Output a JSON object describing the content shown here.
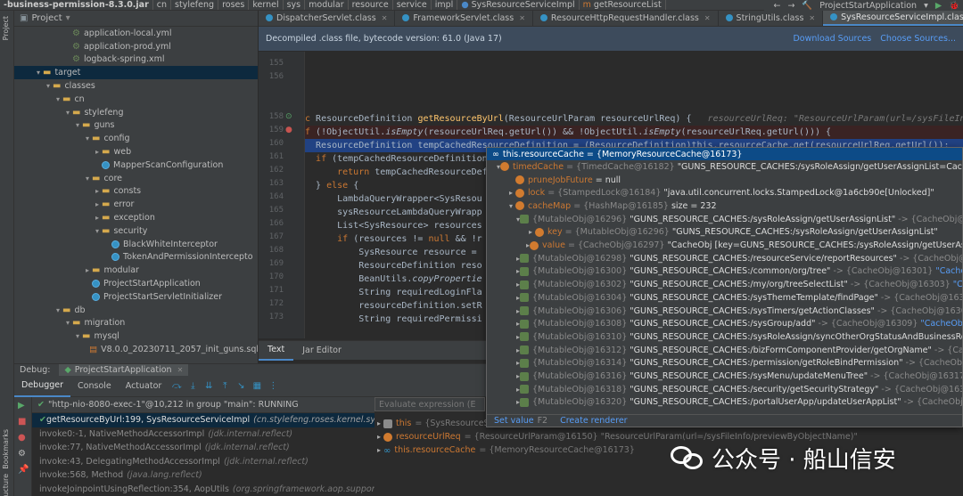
{
  "breadcrumbs": [
    "-business-permission-8.3.0.jar",
    "cn",
    "stylefeng",
    "roses",
    "kernel",
    "sys",
    "modular",
    "resource",
    "service",
    "impl",
    "SysResourceServiceImpl",
    "getResourceList"
  ],
  "run_config": "ProjectStartApplication",
  "project": {
    "title": "Project",
    "tree": [
      {
        "label": "application-local.yml",
        "indent": 5,
        "icon": "yml"
      },
      {
        "label": "application-prod.yml",
        "indent": 5,
        "icon": "yml"
      },
      {
        "label": "logback-spring.xml",
        "indent": 5,
        "icon": "yml"
      },
      {
        "label": "target",
        "indent": 2,
        "icon": "folder",
        "open": true,
        "selected": true
      },
      {
        "label": "classes",
        "indent": 3,
        "icon": "folder",
        "open": true
      },
      {
        "label": "cn",
        "indent": 4,
        "icon": "folder",
        "open": true
      },
      {
        "label": "stylefeng",
        "indent": 5,
        "icon": "folder",
        "open": true
      },
      {
        "label": "guns",
        "indent": 6,
        "icon": "folder",
        "open": true
      },
      {
        "label": "config",
        "indent": 7,
        "icon": "folder",
        "open": true
      },
      {
        "label": "web",
        "indent": 8,
        "icon": "folder",
        "open": false
      },
      {
        "label": "MapperScanConfiguration",
        "indent": 8,
        "icon": "class"
      },
      {
        "label": "core",
        "indent": 7,
        "icon": "folder",
        "open": true
      },
      {
        "label": "consts",
        "indent": 8,
        "icon": "folder",
        "open": false
      },
      {
        "label": "error",
        "indent": 8,
        "icon": "folder",
        "open": false
      },
      {
        "label": "exception",
        "indent": 8,
        "icon": "folder",
        "open": false
      },
      {
        "label": "security",
        "indent": 8,
        "icon": "folder",
        "open": true
      },
      {
        "label": "BlackWhiteInterceptor",
        "indent": 9,
        "icon": "class"
      },
      {
        "label": "TokenAndPermissionIntercepto",
        "indent": 9,
        "icon": "class"
      },
      {
        "label": "modular",
        "indent": 7,
        "icon": "folder",
        "open": false
      },
      {
        "label": "ProjectStartApplication",
        "indent": 7,
        "icon": "class"
      },
      {
        "label": "ProjectStartServletInitializer",
        "indent": 7,
        "icon": "class"
      },
      {
        "label": "db",
        "indent": 4,
        "icon": "folder",
        "open": true
      },
      {
        "label": "migration",
        "indent": 5,
        "icon": "folder",
        "open": true
      },
      {
        "label": "mysql",
        "indent": 6,
        "icon": "folder",
        "open": true
      },
      {
        "label": "V8.0.0_20230711_2057_init_guns.sql",
        "indent": 7,
        "icon": "sql"
      }
    ]
  },
  "tabs": [
    {
      "label": "DispatcherServlet.class",
      "active": false
    },
    {
      "label": "FrameworkServlet.class",
      "active": false
    },
    {
      "label": "ResourceHttpRequestHandler.class",
      "active": false
    },
    {
      "label": "StringUtils.class",
      "active": false
    },
    {
      "label": "SysResourceServiceImpl.class",
      "active": true
    }
  ],
  "banner": {
    "text": "Decompiled .class file, bytecode version: 61.0 (Java 17)",
    "download": "Download Sources",
    "choose": "Choose Sources..."
  },
  "editor": {
    "lines": [
      {
        "n": "155",
        "parts": []
      },
      {
        "n": "156",
        "parts": []
      },
      {
        "n": "",
        "parts": []
      },
      {
        "n": "",
        "parts": []
      },
      {
        "n": "158",
        "parts": [
          {
            "c": "kw",
            "t": "c "
          },
          {
            "c": "",
            "t": "ResourceDefinition "
          },
          {
            "c": "fn",
            "t": "getResourceByUrl"
          },
          {
            "c": "",
            "t": "(ResourceUrlParam resourceUrlReq) {   "
          },
          {
            "c": "hint",
            "t": "resourceUrlReq: \"ResourceUrlParam(url=/sysFileInfo/previewByObjectName)\""
          }
        ]
      },
      {
        "n": "159",
        "parts": [
          {
            "c": "kw",
            "t": "f "
          },
          {
            "c": "",
            "t": "(!ObjectUtil."
          },
          {
            "c": "it",
            "t": "isEmpty"
          },
          {
            "c": "",
            "t": "(resourceUrlReq.getUrl()) && !ObjectUtil."
          },
          {
            "c": "it",
            "t": "isEmpty"
          },
          {
            "c": "",
            "t": "(resourceUrlReq.getUrl())) {"
          }
        ]
      },
      {
        "n": "160",
        "parts": [
          {
            "c": "",
            "t": "  ResourceDefinition tempCachedResourceDefinition = (ResourceDefinition)this.resourceCache.get(resourceUrlReq.getUrl());"
          }
        ]
      },
      {
        "n": "161",
        "parts": [
          {
            "c": "",
            "t": "  "
          },
          {
            "c": "kw",
            "t": "if "
          },
          {
            "c": "",
            "t": "(tempCachedResourceDefinition"
          }
        ]
      },
      {
        "n": "162",
        "parts": [
          {
            "c": "",
            "t": "      "
          },
          {
            "c": "kw",
            "t": "return "
          },
          {
            "c": "",
            "t": "tempCachedResourceDefinition"
          }
        ]
      },
      {
        "n": "163",
        "parts": [
          {
            "c": "",
            "t": "  } "
          },
          {
            "c": "kw",
            "t": "else "
          },
          {
            "c": "",
            "t": "{"
          }
        ]
      },
      {
        "n": "164",
        "parts": [
          {
            "c": "",
            "t": "      LambdaQueryWrapper<SysResou"
          }
        ]
      },
      {
        "n": "165",
        "parts": [
          {
            "c": "",
            "t": "      sysResourceLambdaQueryWrapp"
          }
        ]
      },
      {
        "n": "166",
        "parts": [
          {
            "c": "",
            "t": "      List<SysResource> resources"
          }
        ]
      },
      {
        "n": "167",
        "parts": [
          {
            "c": "",
            "t": "      "
          },
          {
            "c": "kw",
            "t": "if "
          },
          {
            "c": "",
            "t": "(resources != "
          },
          {
            "c": "kw",
            "t": "null "
          },
          {
            "c": "",
            "t": "&& !r"
          }
        ]
      },
      {
        "n": "168",
        "parts": [
          {
            "c": "",
            "t": "          SysResource resource = "
          }
        ]
      },
      {
        "n": "169",
        "parts": [
          {
            "c": "",
            "t": "          ResourceDefinition reso"
          }
        ]
      },
      {
        "n": "170",
        "parts": [
          {
            "c": "",
            "t": "          BeanUtils."
          },
          {
            "c": "it",
            "t": "copyPropertie"
          }
        ]
      },
      {
        "n": "171",
        "parts": [
          {
            "c": "",
            "t": "          String requiredLoginFla"
          }
        ]
      },
      {
        "n": "172",
        "parts": [
          {
            "c": "",
            "t": "          resourceDefinition.setR"
          }
        ]
      },
      {
        "n": "173",
        "parts": [
          {
            "c": "",
            "t": "          String requiredPermissi"
          }
        ]
      }
    ]
  },
  "editor_tabs": [
    "Text",
    "Jar Editor"
  ],
  "debug": {
    "label": "Debug:",
    "session": "ProjectStartApplication",
    "tabs": [
      "Debugger",
      "Console",
      "Actuator"
    ],
    "thread": "\"http-nio-8080-exec-1\"@10,212 in group \"main\": RUNNING",
    "frames": [
      {
        "m": "getResourceByUrl:199, SysResourceServiceImpl",
        "loc": "(cn.stylefeng.roses.kernel.sys.modula",
        "sel": true
      },
      {
        "m": "invoke0:-1, NativeMethodAccessorImpl",
        "loc": "(jdk.internal.reflect)",
        "sel": false
      },
      {
        "m": "invoke:77, NativeMethodAccessorImpl",
        "loc": "(jdk.internal.reflect)",
        "sel": false
      },
      {
        "m": "invoke:43, DelegatingMethodAccessorImpl",
        "loc": "(jdk.internal.reflect)",
        "sel": false
      },
      {
        "m": "invoke:568, Method",
        "loc": "(java.lang.reflect)",
        "sel": false
      },
      {
        "m": "invokeJoinpointUsingReflection:354, AopUtils",
        "loc": "(org.springframework.aop.support)",
        "sel": false
      }
    ],
    "eval_placeholder": "Evaluate expression (E",
    "vars": [
      {
        "name": "this",
        "val": "= {SysResourceS"
      },
      {
        "name": "resourceUrlReq",
        "val": "= {ResourceUrlParam@16150} \"ResourceUrlParam(url=/sysFileInfo/previewByObjectName)\""
      },
      {
        "name": "this.resourceCache",
        "val": "= {MemoryResourceCache@16173}"
      }
    ]
  },
  "popup": {
    "header": "this.resourceCache = {MemoryResourceCache@16173}",
    "rows": [
      {
        "indent": 1,
        "tw": "v",
        "icon": "f",
        "name": "timedCache",
        "type": "= {TimedCache@16182}",
        "val": "\"GUNS_RESOURCE_CACHES:/sysRoleAssign/getUserAssignList=CacheO"
      },
      {
        "indent": 2,
        "tw": "",
        "icon": "f",
        "name": "pruneJobFuture",
        "type": "",
        "val": "= null"
      },
      {
        "indent": 2,
        "tw": ">",
        "icon": "f",
        "name": "lock",
        "type": "= {StampedLock@16184}",
        "val": "\"java.util.concurrent.locks.StampedLock@1a6cb90e[Unlocked]\""
      },
      {
        "indent": 2,
        "tw": "v",
        "icon": "f",
        "name": "cacheMap",
        "type": "= {HashMap@16185}",
        "val": "size = 232"
      },
      {
        "indent": 3,
        "tw": "v",
        "icon": "e",
        "name": "",
        "type": "{MutableObj@16296}",
        "val": "\"GUNS_RESOURCE_CACHES:/sysRoleAssign/getUserAssignList\"",
        "arrow": "->",
        "obj": "{CacheObj@16",
        "vi": "Vie"
      },
      {
        "indent": 4,
        "tw": ">",
        "icon": "f",
        "name": "key",
        "type": "= {MutableObj@16296}",
        "val": "\"GUNS_RESOURCE_CACHES:/sysRoleAssign/getUserAssignList\""
      },
      {
        "indent": 4,
        "tw": ">",
        "icon": "f",
        "name": "value",
        "type": "= {CacheObj@16297}",
        "val": "\"CacheObj [key=GUNS_RESOURCE_CACHES:/sysRoleAssign/getUserAss"
      },
      {
        "indent": 3,
        "tw": ">",
        "icon": "e",
        "name": "",
        "type": "{MutableObj@16298}",
        "val": "\"GUNS_RESOURCE_CACHES:/resourceService/reportResources\"",
        "arrow": "->",
        "obj": "{CacheObj@16",
        "vi": "Vie"
      },
      {
        "indent": 3,
        "tw": ">",
        "icon": "e",
        "name": "",
        "type": "{MutableObj@16300}",
        "val": "\"GUNS_RESOURCE_CACHES:/common/org/tree\"",
        "arrow": "->",
        "obj": "{CacheObj@16301}",
        "vi": "\"CacheO"
      },
      {
        "indent": 3,
        "tw": ">",
        "icon": "e",
        "name": "",
        "type": "{MutableObj@16302}",
        "val": "\"GUNS_RESOURCE_CACHES:/my/org/treeSelectList\"",
        "arrow": "->",
        "obj": "{CacheObj@16303}",
        "vi": "\"Ca"
      },
      {
        "indent": 3,
        "tw": ">",
        "icon": "e",
        "name": "",
        "type": "{MutableObj@16304}",
        "val": "\"GUNS_RESOURCE_CACHES:/sysThemeTemplate/findPage\"",
        "arrow": "->",
        "obj": "{CacheObj@1630",
        "vi": ""
      },
      {
        "indent": 3,
        "tw": ">",
        "icon": "e",
        "name": "",
        "type": "{MutableObj@16306}",
        "val": "\"GUNS_RESOURCE_CACHES:/sysTimers/getActionClasses\"",
        "arrow": "->",
        "obj": "{CacheObj@16307",
        "vi": ""
      },
      {
        "indent": 3,
        "tw": ">",
        "icon": "e",
        "name": "",
        "type": "{MutableObj@16308}",
        "val": "\"GUNS_RESOURCE_CACHES:/sysGroup/add\"",
        "arrow": "->",
        "obj": "{CacheObj@16309}",
        "vi": "\"CacheObj [k"
      },
      {
        "indent": 3,
        "tw": ">",
        "icon": "e",
        "name": "",
        "type": "{MutableObj@16310}",
        "val": "\"GUNS_RESOURCE_CACHES:/sysRoleAssign/syncOtherOrgStatusAndBusinessRo",
        "arrow": "",
        "obj": "",
        "vi": ""
      },
      {
        "indent": 3,
        "tw": ">",
        "icon": "e",
        "name": "",
        "type": "{MutableObj@16312}",
        "val": "\"GUNS_RESOURCE_CACHES:/bizFormComponentProvider/getOrgName\"",
        "arrow": "->",
        "obj": "{CacheObj@",
        "vi": "Vie"
      },
      {
        "indent": 3,
        "tw": ">",
        "icon": "e",
        "name": "",
        "type": "{MutableObj@16314}",
        "val": "\"GUNS_RESOURCE_CACHES:/permission/getRoleBindPermission\"",
        "arrow": "->",
        "obj": "{CacheObj@16",
        "vi": ""
      },
      {
        "indent": 3,
        "tw": ">",
        "icon": "e",
        "name": "",
        "type": "{MutableObj@16316}",
        "val": "\"GUNS_RESOURCE_CACHES:/sysMenu/updateMenuTree\"",
        "arrow": "->",
        "obj": "{CacheObj@16317}",
        "vi": "..."
      },
      {
        "indent": 3,
        "tw": ">",
        "icon": "e",
        "name": "",
        "type": "{MutableObj@16318}",
        "val": "\"GUNS_RESOURCE_CACHES:/security/getSecurityStrategy\"",
        "arrow": "->",
        "obj": "{CacheObj@1631",
        "vi": ""
      },
      {
        "indent": 3,
        "tw": ">",
        "icon": "e",
        "name": "",
        "type": "{MutableObj@16320}",
        "val": "\"GUNS_RESOURCE_CACHES:/portalUserApp/updateUserAppList\"",
        "arrow": "->",
        "obj": "{CacheObj@16",
        "vi": "Vie"
      }
    ],
    "set_value": "Set value",
    "set_key": "F2",
    "create_renderer": "Create renderer"
  },
  "watermark": "公众号 · 船山信安",
  "colors": {
    "accent": "#4a88c7",
    "selection": "#214283",
    "keyword": "#cc7832",
    "method": "#ffc66d"
  }
}
